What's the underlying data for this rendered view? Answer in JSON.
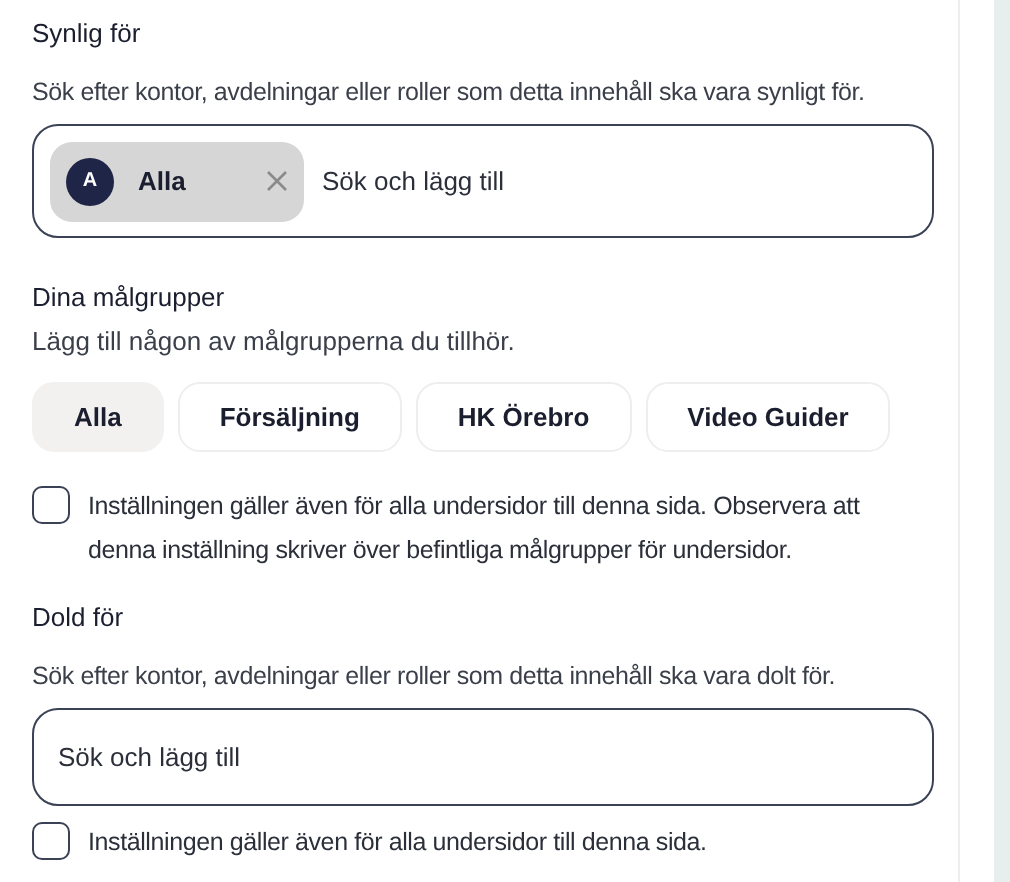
{
  "visible_for": {
    "title": "Synlig för",
    "description": "Sök efter kontor, avdelningar eller roller som detta innehåll ska vara synligt för.",
    "chips": [
      {
        "initial": "A",
        "label": "Alla"
      }
    ],
    "placeholder": "Sök och lägg till"
  },
  "audiences": {
    "title": "Dina målgrupper",
    "description": "Lägg till någon av målgrupperna du tillhör.",
    "options": [
      {
        "label": "Alla",
        "selected": true
      },
      {
        "label": "Försäljning",
        "selected": false
      },
      {
        "label": "HK Örebro",
        "selected": false
      },
      {
        "label": "Video Guider",
        "selected": false
      }
    ],
    "apply_to_subpages": {
      "label": "Inställningen gäller även för alla undersidor till denna sida. Observera att denna inställning skriver över befintliga målgrupper för undersidor.",
      "checked": false
    }
  },
  "hidden_for": {
    "title": "Dold för",
    "description": "Sök efter kontor, avdelningar eller roller som detta innehåll ska vara dolt för.",
    "placeholder": "Sök och lägg till",
    "apply_to_subpages": {
      "label": "Inställningen gäller även för alla undersidor till denna sida.",
      "checked": false
    }
  }
}
